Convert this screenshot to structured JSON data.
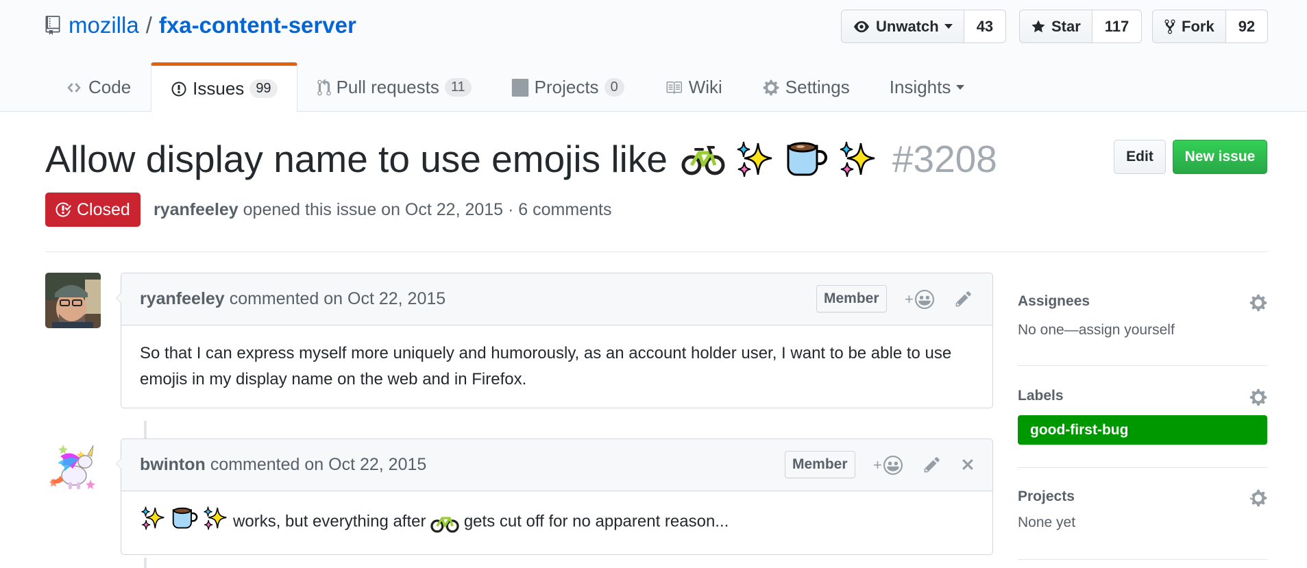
{
  "repo": {
    "owner": "mozilla",
    "separator": "/",
    "name": "fxa-content-server",
    "watch_label": "Unwatch",
    "watch_count": "43",
    "star_label": "Star",
    "star_count": "117",
    "fork_label": "Fork",
    "fork_count": "92"
  },
  "tabs": [
    {
      "label": "Code",
      "count": ""
    },
    {
      "label": "Issues",
      "count": "99"
    },
    {
      "label": "Pull requests",
      "count": "11"
    },
    {
      "label": "Projects",
      "count": "0"
    },
    {
      "label": "Wiki",
      "count": ""
    },
    {
      "label": "Settings",
      "count": ""
    },
    {
      "label": "Insights",
      "count": ""
    }
  ],
  "issue": {
    "title": "Allow display name to use emojis like",
    "title_emojis": [
      "bicycle-emoji",
      "sparkles-emoji",
      "coffee-emoji",
      "sparkles-emoji"
    ],
    "number": "#3208",
    "state": "Closed",
    "author": "ryanfeeley",
    "meta_text": "opened this issue on Oct 22, 2015 · 6 comments",
    "edit_label": "Edit",
    "new_issue_label": "New issue"
  },
  "comments": [
    {
      "author": "ryanfeeley",
      "action": "commented on Oct 22, 2015",
      "badge": "Member",
      "body": "So that I can express myself more uniquely and humorously, as an account holder user, I want to be able to use emojis in my display name on the web and in Firefox."
    },
    {
      "author": "bwinton",
      "action": "commented on Oct 22, 2015",
      "badge": "Member",
      "body_part1": "works, but everything after",
      "body_part2": "gets cut off for no apparent reason..."
    }
  ],
  "sidebar": {
    "assignees_title": "Assignees",
    "assignees_value": "No one—assign yourself",
    "labels_title": "Labels",
    "label_name": "good-first-bug",
    "label_color": "#009800",
    "projects_title": "Projects",
    "projects_value": "None yet"
  },
  "colors": {
    "link": "#0366d6",
    "closed": "#cb2431",
    "new_issue": "#28a745",
    "selected_tab_accent": "#e36209"
  },
  "plus_sign": "+"
}
